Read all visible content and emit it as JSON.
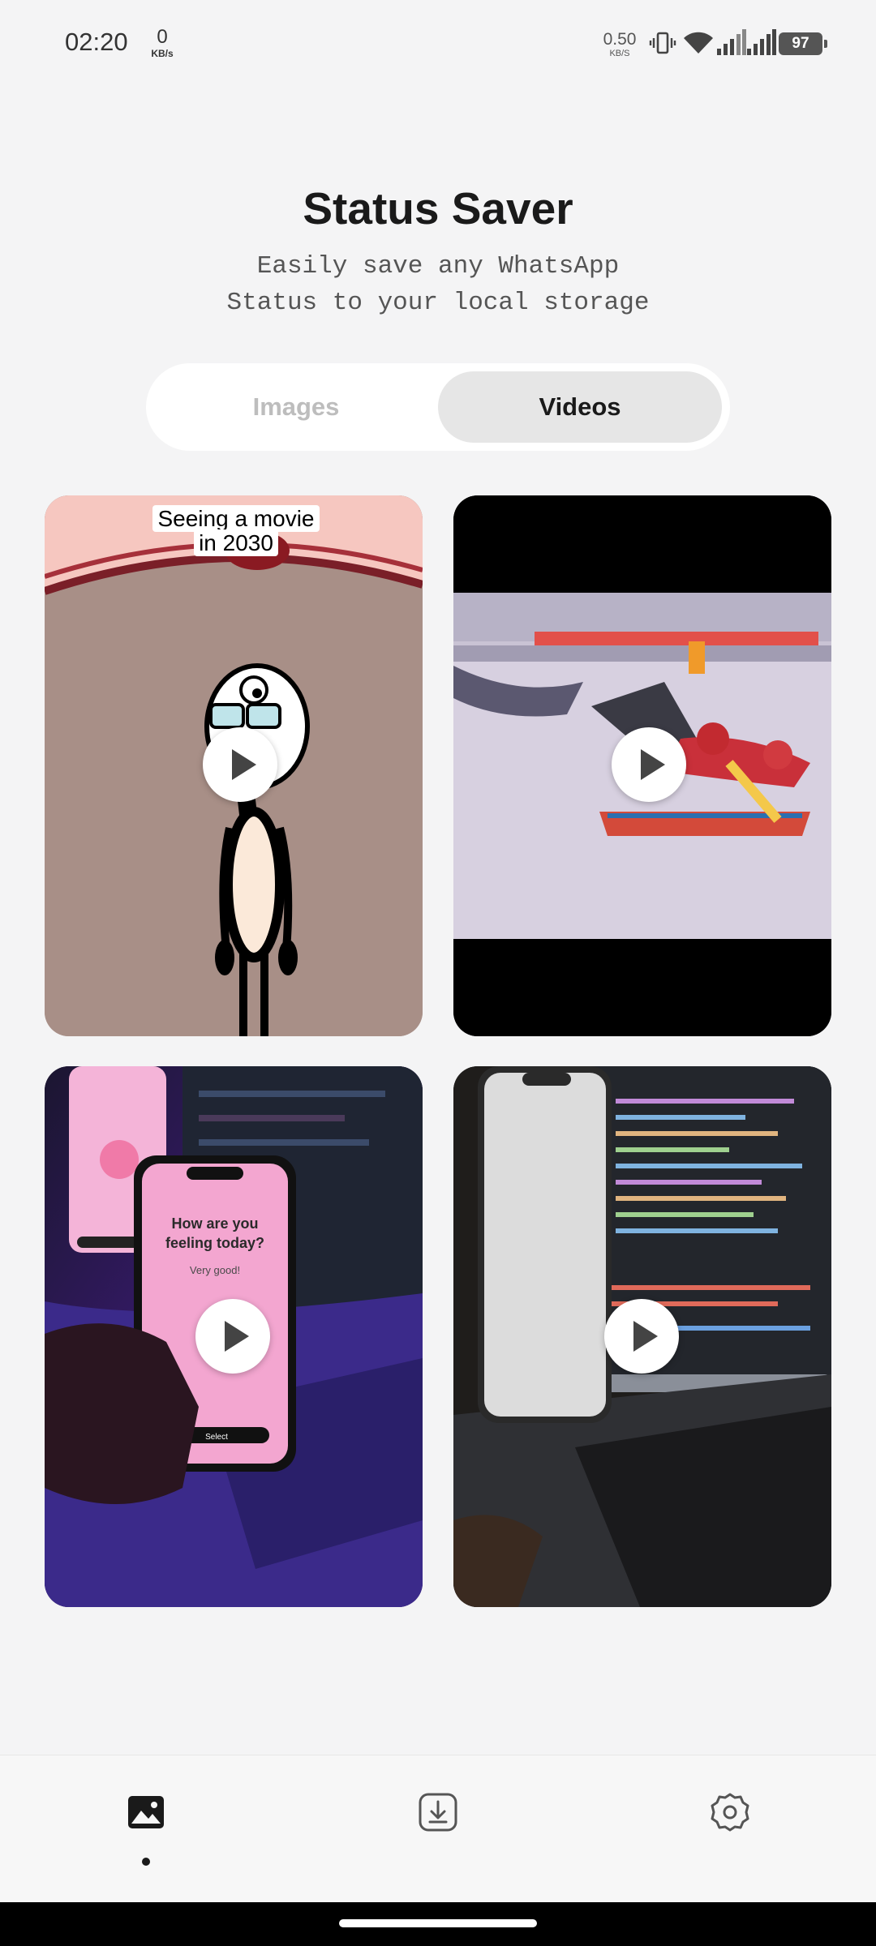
{
  "status_bar": {
    "time": "02:20",
    "net_speed_left": "0",
    "net_speed_left_unit": "KB/s",
    "net_speed_right": "0.50",
    "net_speed_right_unit": "KB/S",
    "battery": "97",
    "icons": [
      "vibrate-icon",
      "wifi-icon",
      "signal-icon",
      "signal-icon",
      "battery-icon"
    ]
  },
  "header": {
    "title": "Status Saver",
    "subtitle": "Easily save any WhatsApp\nStatus to your local storage"
  },
  "tabs": [
    {
      "label": "Images",
      "selected": false
    },
    {
      "label": "Videos",
      "selected": true
    }
  ],
  "videos": [
    {
      "caption": "Seeing a movie in 2030",
      "icon": "play-icon"
    },
    {
      "caption": "",
      "icon": "play-icon"
    },
    {
      "caption": "",
      "icon": "play-icon"
    },
    {
      "caption": "",
      "icon": "play-icon"
    }
  ],
  "bottom_nav": {
    "items": [
      {
        "icon": "gallery-icon",
        "active": true
      },
      {
        "icon": "download-icon",
        "active": false
      },
      {
        "icon": "settings-icon",
        "active": false
      }
    ]
  }
}
